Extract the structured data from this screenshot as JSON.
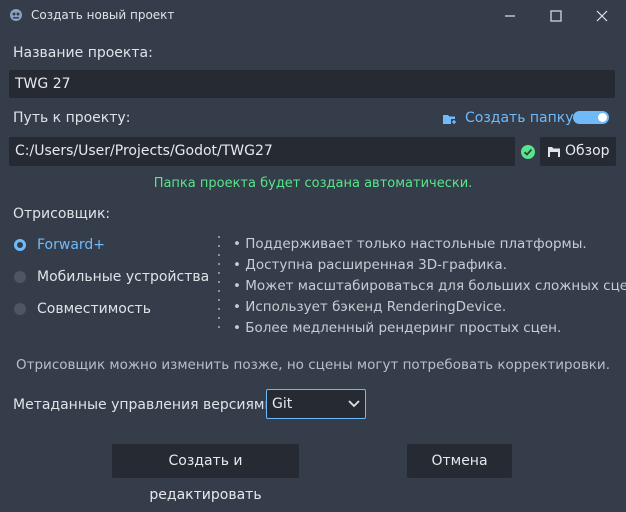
{
  "window": {
    "title": "Создать новый проект"
  },
  "project_name": {
    "label": "Название проекта:",
    "value": "TWG 27"
  },
  "project_path": {
    "label": "Путь к проекту:",
    "create_folder_label": "Создать папку",
    "create_folder_enabled": true,
    "value": "C:/Users/User/Projects/Godot/TWG27",
    "browse_label": "Обзор",
    "status": "Папка проекта будет создана автоматически."
  },
  "renderer": {
    "label": "Отрисовщик:",
    "options": [
      {
        "label": "Forward+",
        "selected": true
      },
      {
        "label": "Мобильные устройства",
        "selected": false
      },
      {
        "label": "Совместимость",
        "selected": false
      }
    ],
    "features": [
      "Поддерживает только настольные платформы.",
      "Доступна расширенная 3D-графика.",
      "Может масштабироваться для больших сложных сцен.",
      "Использует бэкенд RenderingDevice.",
      "Более медленный рендеринг простых сцен."
    ],
    "note": "Отрисовщик можно изменить позже, но сцены могут потребовать корректировки."
  },
  "vcs": {
    "label": "Метаданные управления версиями",
    "value": "Git"
  },
  "actions": {
    "create_label": "Создать и редактировать",
    "cancel_label": "Отмена"
  },
  "colors": {
    "background": "#363d4a",
    "field": "#262b33",
    "accent": "#70bafa",
    "success": "#57e58a"
  }
}
